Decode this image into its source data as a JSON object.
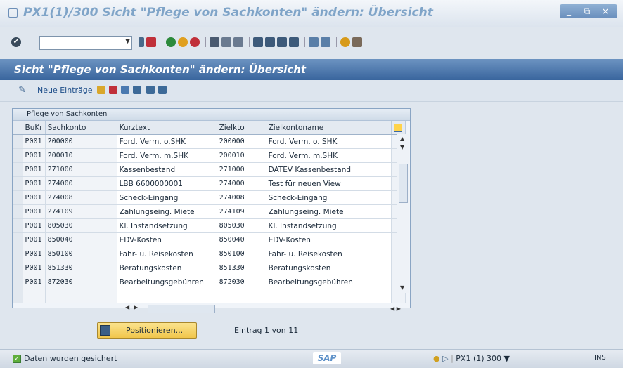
{
  "window": {
    "title": "PX1(1)/300 Sicht \"Pflege von Sachkonten\" ändern: Übersicht",
    "buttons": [
      "_",
      "⧉",
      "×"
    ]
  },
  "toolbar": {
    "command_value": "",
    "icons": [
      "back-icon",
      "save-icon",
      "nav-back-icon",
      "exit-icon",
      "cancel-icon",
      "print-icon",
      "find-icon",
      "find-next-icon",
      "first-page-icon",
      "prev-page-icon",
      "next-page-icon",
      "last-page-icon",
      "new-session-icon",
      "shortcut-icon",
      "help-icon",
      "layout-icon"
    ]
  },
  "header": {
    "title": "Sicht \"Pflege von Sachkonten\" ändern: Übersicht"
  },
  "app_toolbar": {
    "new_entries_label": "Neue Einträge",
    "icons": [
      "copy-icon",
      "delete-icon",
      "undo-icon",
      "select-all-icon",
      "select-block-icon",
      "deselect-all-icon"
    ]
  },
  "table": {
    "caption": "Pflege von Sachkonten",
    "columns": [
      "BuKr",
      "Sachkonto",
      "Kurztext",
      "Zielkto",
      "Zielkontoname"
    ],
    "rows": [
      [
        "P001",
        "200000",
        "Ford. Verm. o.SHK",
        "200000",
        "Ford. Verm. o. SHK"
      ],
      [
        "P001",
        "200010",
        "Ford. Verm. m.SHK",
        "200010",
        "Ford. Verm. m.SHK"
      ],
      [
        "P001",
        "271000",
        "Kassenbestand",
        "271000",
        "DATEV Kassenbestand"
      ],
      [
        "P001",
        "274000",
        "LBB 6600000001",
        "274000",
        "Test für neuen View"
      ],
      [
        "P001",
        "274008",
        "Scheck-Eingang",
        "274008",
        "Scheck-Eingang"
      ],
      [
        "P001",
        "274109",
        "Zahlungseing. Miete",
        "274109",
        "Zahlungseing. Miete"
      ],
      [
        "P001",
        "805030",
        "Kl. Instandsetzung",
        "805030",
        "Kl. Instandsetzung"
      ],
      [
        "P001",
        "850040",
        "EDV-Kosten",
        "850040",
        "EDV-Kosten"
      ],
      [
        "P001",
        "850100",
        "Fahr- u. Reisekosten",
        "850100",
        "Fahr- u. Reisekosten"
      ],
      [
        "P001",
        "851330",
        "Beratungskosten",
        "851330",
        "Beratungskosten"
      ],
      [
        "P001",
        "872030",
        "Bearbeitungsgebühren",
        "872030",
        "Bearbeitungsgebühren"
      ],
      [
        "",
        "",
        "",
        "",
        ""
      ]
    ]
  },
  "footer": {
    "position_button": "Positionieren...",
    "entry_info": "Eintrag 1 von 11"
  },
  "status": {
    "message": "Daten wurden gesichert",
    "logo": "SAP",
    "system": "PX1 (1) 300",
    "mode": "INS"
  }
}
